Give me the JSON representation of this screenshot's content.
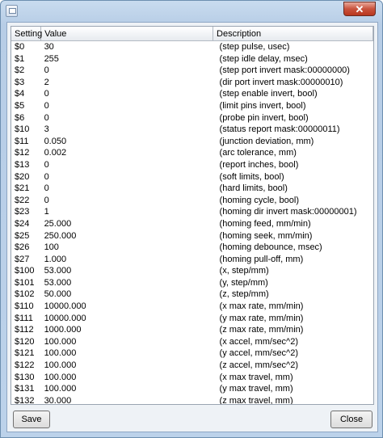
{
  "window": {
    "title": "",
    "close_glyph": "✕"
  },
  "table": {
    "columns": [
      "Setting",
      "Value",
      "Description"
    ],
    "rows": [
      [
        "$0",
        "30",
        "(step pulse, usec)"
      ],
      [
        "$1",
        "255",
        "(step idle delay, msec)"
      ],
      [
        "$2",
        "0",
        "(step port invert mask:00000000)"
      ],
      [
        "$3",
        "2",
        "(dir port invert mask:00000010)"
      ],
      [
        "$4",
        "0",
        "(step enable invert, bool)"
      ],
      [
        "$5",
        "0",
        "(limit pins invert, bool)"
      ],
      [
        "$6",
        "0",
        "(probe pin invert, bool)"
      ],
      [
        "$10",
        "3",
        "(status report mask:00000011)"
      ],
      [
        "$11",
        "0.050",
        "(junction deviation, mm)"
      ],
      [
        "$12",
        "0.002",
        "(arc tolerance, mm)"
      ],
      [
        "$13",
        "0",
        "(report inches, bool)"
      ],
      [
        "$20",
        "0",
        "(soft limits, bool)"
      ],
      [
        "$21",
        "0",
        "(hard limits, bool)"
      ],
      [
        "$22",
        "0",
        "(homing cycle, bool)"
      ],
      [
        "$23",
        "1",
        "(homing dir invert mask:00000001)"
      ],
      [
        "$24",
        "25.000",
        "(homing feed, mm/min)"
      ],
      [
        "$25",
        "250.000",
        "(homing seek, mm/min)"
      ],
      [
        "$26",
        "100",
        "(homing debounce, msec)"
      ],
      [
        "$27",
        "1.000",
        "(homing pull-off, mm)"
      ],
      [
        "$100",
        "53.000",
        "(x, step/mm)"
      ],
      [
        "$101",
        "53.000",
        "(y, step/mm)"
      ],
      [
        "$102",
        "50.000",
        "(z, step/mm)"
      ],
      [
        "$110",
        "10000.000",
        "(x max rate, mm/min)"
      ],
      [
        "$111",
        "10000.000",
        "(y max rate, mm/min)"
      ],
      [
        "$112",
        "1000.000",
        "(z max rate, mm/min)"
      ],
      [
        "$120",
        "100.000",
        "(x accel, mm/sec^2)"
      ],
      [
        "$121",
        "100.000",
        "(y accel, mm/sec^2)"
      ],
      [
        "$122",
        "100.000",
        "(z accel, mm/sec^2)"
      ],
      [
        "$130",
        "100.000",
        "(x max travel, mm)"
      ],
      [
        "$131",
        "100.000",
        "(y max travel, mm)"
      ],
      [
        "$132",
        "30.000",
        "(z max travel, mm)"
      ]
    ]
  },
  "buttons": {
    "save_label": "Save",
    "close_label": "Close"
  }
}
